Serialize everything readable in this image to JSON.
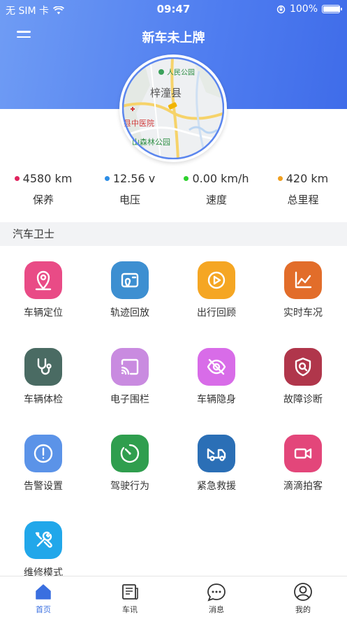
{
  "status_bar": {
    "carrier": "无 SIM 卡",
    "time": "09:47",
    "battery": "100%",
    "battery_level": 1.0
  },
  "header": {
    "title": "新车未上牌"
  },
  "map": {
    "label_park": "人民公园",
    "label_county": "梓潼县",
    "label_hospital": "县中医院",
    "label_forest": "山森林公园"
  },
  "stats": [
    {
      "value": "4580 km",
      "label": "保养",
      "dot_color": "#e0245e"
    },
    {
      "value": "12.56 v",
      "label": "电压",
      "dot_color": "#2d8ee6"
    },
    {
      "value": "0.00 km/h",
      "label": "速度",
      "dot_color": "#2ed12e"
    },
    {
      "value": "420 km",
      "label": "总里程",
      "dot_color": "#f0a020"
    }
  ],
  "section_title": "汽车卫士",
  "features": [
    {
      "label": "车辆定位",
      "color": "#e94b86",
      "icon": "location-pin-icon"
    },
    {
      "label": "轨迹回放",
      "color": "#3d8fd1",
      "icon": "track-map-icon"
    },
    {
      "label": "出行回顾",
      "color": "#f5a623",
      "icon": "play-circle-icon"
    },
    {
      "label": "实时车况",
      "color": "#e26d2a",
      "icon": "line-chart-icon"
    },
    {
      "label": "车辆体检",
      "color": "#4a6b63",
      "icon": "stethoscope-icon"
    },
    {
      "label": "电子围栏",
      "color": "#c98be0",
      "icon": "cast-icon"
    },
    {
      "label": "车辆隐身",
      "color": "#d86ce8",
      "icon": "eye-off-icon"
    },
    {
      "label": "故障诊断",
      "color": "#b0364b",
      "icon": "shield-search-icon"
    },
    {
      "label": "告警设置",
      "color": "#5b93e8",
      "icon": "alert-circle-icon"
    },
    {
      "label": "驾驶行为",
      "color": "#2f9e4e",
      "icon": "speedometer-icon"
    },
    {
      "label": "紧急救援",
      "color": "#2b6fb6",
      "icon": "tow-truck-icon"
    },
    {
      "label": "滴滴拍客",
      "color": "#e3467a",
      "icon": "video-camera-icon"
    },
    {
      "label": "维修模式",
      "color": "#21a7ea",
      "icon": "tools-icon"
    }
  ],
  "tabs": [
    {
      "label": "首页",
      "icon": "home-icon",
      "active": true
    },
    {
      "label": "车讯",
      "icon": "news-icon",
      "active": false
    },
    {
      "label": "消息",
      "icon": "chat-bubble-icon",
      "active": false
    },
    {
      "label": "我的",
      "icon": "profile-icon",
      "active": false
    }
  ],
  "colors": {
    "accent": "#3a6fe0",
    "header_start": "#6f9cf4",
    "header_end": "#3f6ce9"
  }
}
